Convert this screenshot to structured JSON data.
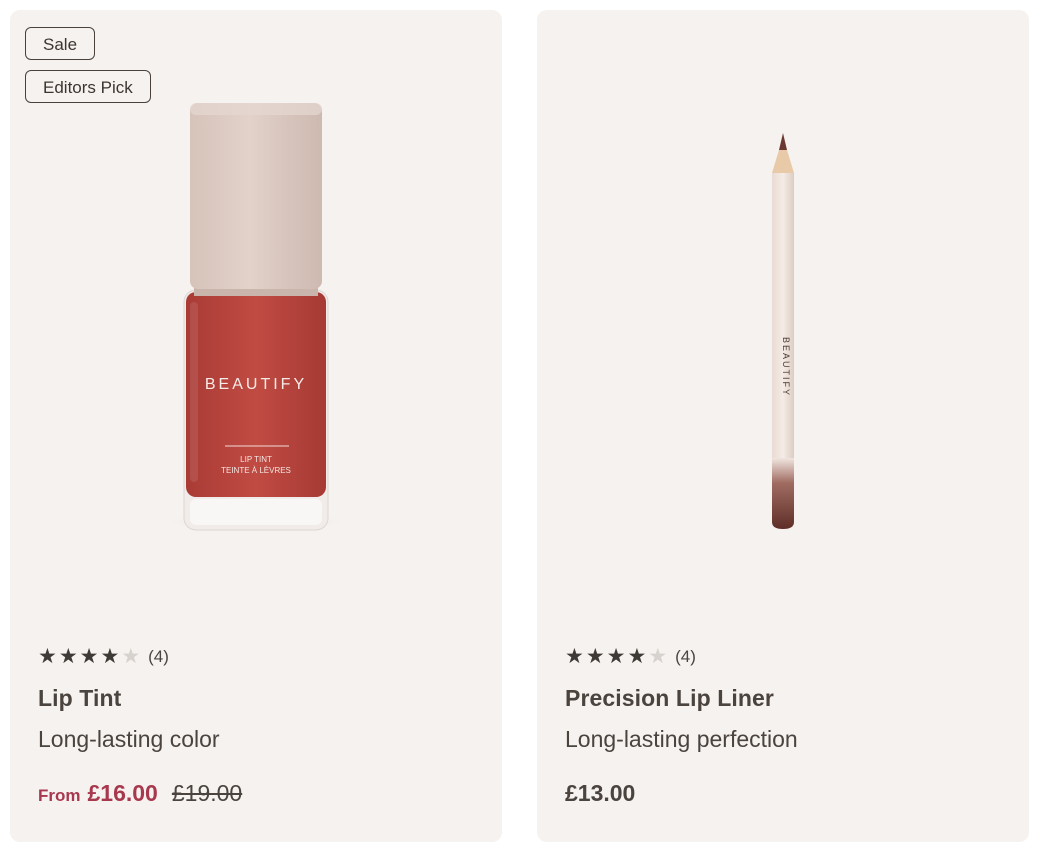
{
  "products": [
    {
      "badges": [
        "Sale",
        "Editors Pick"
      ],
      "rating_stars": 4,
      "rating_max": 5,
      "rating_count": "(4)",
      "name": "Lip Tint",
      "description": "Long-lasting color",
      "price_prefix": "From",
      "price": "£16.00",
      "original_price": "£19.00",
      "image": {
        "type": "nail-polish-bottle",
        "brand": "BEAUTIFY",
        "label_line1": "LIP TINT",
        "label_line2": "TEINTE À LÈVRES",
        "color": "#b8463f"
      }
    },
    {
      "badges": [],
      "rating_stars": 4,
      "rating_max": 5,
      "rating_count": "(4)",
      "name": "Precision Lip Liner",
      "description": "Long-lasting perfection",
      "price": "£13.00",
      "image": {
        "type": "lip-liner-pencil",
        "brand": "BEAUTIFY",
        "color": "#6e3a30"
      }
    }
  ],
  "colors": {
    "card_bg": "#f6f2ef",
    "sale_accent": "#a8384e",
    "text": "#4a433e"
  }
}
